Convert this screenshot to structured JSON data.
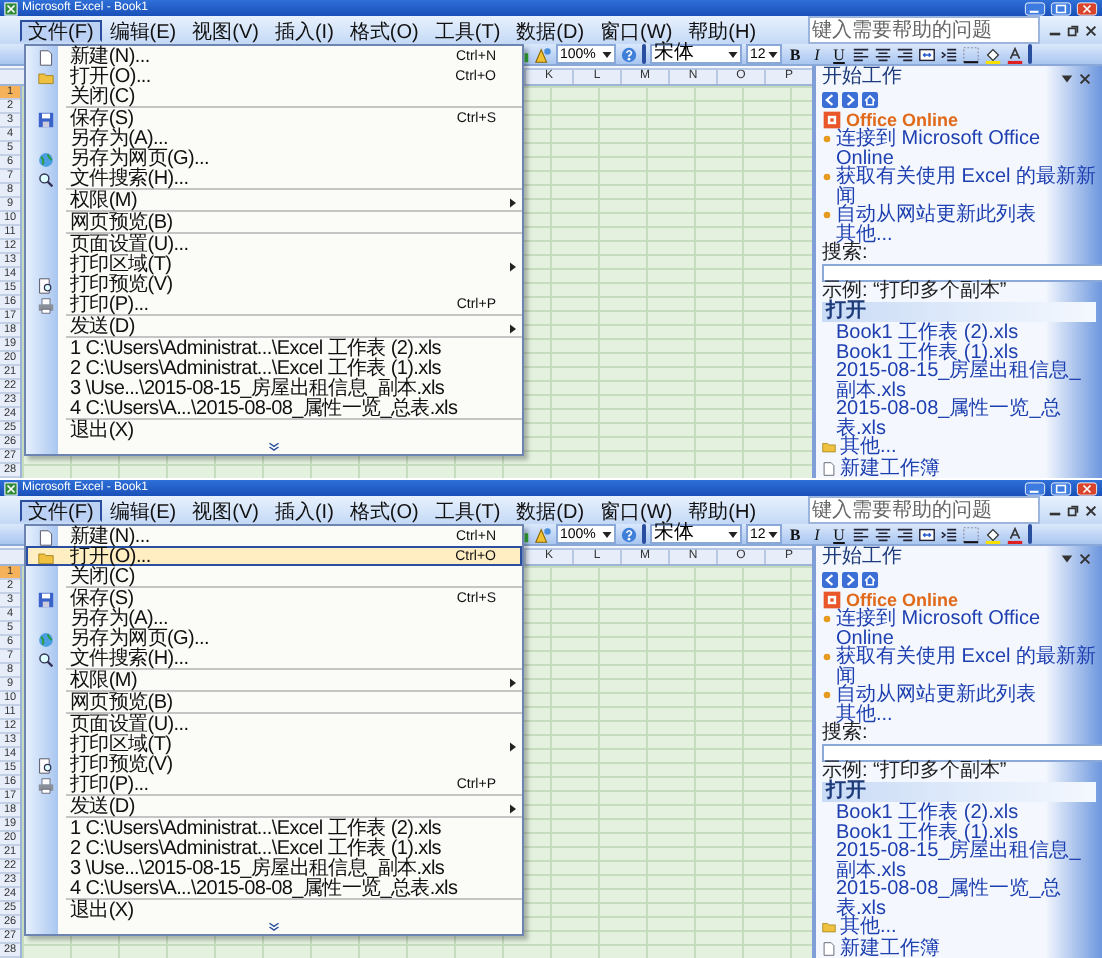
{
  "windows": [
    {
      "title": "Microsoft Excel - Book1",
      "menu_bar": [
        {
          "label": "文件(F)",
          "selected": true
        },
        {
          "label": "编辑(E)",
          "selected": false
        },
        {
          "label": "视图(V)",
          "selected": false
        },
        {
          "label": "插入(I)",
          "selected": false
        },
        {
          "label": "格式(O)",
          "selected": false
        },
        {
          "label": "工具(T)",
          "selected": false
        },
        {
          "label": "数据(D)",
          "selected": false
        },
        {
          "label": "窗口(W)",
          "selected": false
        },
        {
          "label": "帮助(H)",
          "selected": false
        }
      ],
      "help_placeholder": "键入需要帮助的问题",
      "toolbar": {
        "zoom": "100%",
        "font": "宋体",
        "size": "12",
        "format_buttons": [
          "B",
          "I",
          "U"
        ]
      },
      "file_menu": [
        {
          "label": "新建(N)...",
          "shortcut": "Ctrl+N",
          "selected": false,
          "submenu": false,
          "separator_after": false
        },
        {
          "label": "打开(O)...",
          "shortcut": "Ctrl+O",
          "selected": false,
          "submenu": false,
          "separator_after": false
        },
        {
          "label": "关闭(C)",
          "selected": false,
          "submenu": false,
          "separator_after": true
        },
        {
          "label": "保存(S)",
          "shortcut": "Ctrl+S",
          "selected": false,
          "submenu": false,
          "separator_after": false
        },
        {
          "label": "另存为(A)...",
          "selected": false,
          "submenu": false,
          "separator_after": false
        },
        {
          "label": "另存为网页(G)...",
          "selected": false,
          "submenu": false,
          "separator_after": false
        },
        {
          "label": "文件搜索(H)...",
          "selected": false,
          "submenu": false,
          "separator_after": true
        },
        {
          "label": "权限(M)",
          "selected": false,
          "submenu": true,
          "separator_after": true
        },
        {
          "label": "网页预览(B)",
          "selected": false,
          "submenu": false,
          "separator_after": true
        },
        {
          "label": "页面设置(U)...",
          "selected": false,
          "submenu": false,
          "separator_after": false
        },
        {
          "label": "打印区域(T)",
          "selected": false,
          "submenu": true,
          "separator_after": false
        },
        {
          "label": "打印预览(V)",
          "selected": false,
          "submenu": false,
          "separator_after": false
        },
        {
          "label": "打印(P)...",
          "shortcut": "Ctrl+P",
          "selected": false,
          "submenu": false,
          "separator_after": true
        },
        {
          "label": "发送(D)",
          "selected": false,
          "submenu": true,
          "separator_after": true
        },
        {
          "label": "1 C:\\Users\\Administrat...\\Excel 工作表 (2).xls",
          "selected": false,
          "submenu": false,
          "separator_after": false
        },
        {
          "label": "2 C:\\Users\\Administrat...\\Excel 工作表 (1).xls",
          "selected": false,
          "submenu": false,
          "separator_after": false
        },
        {
          "label": "3 \\Use...\\2015-08-15_房屋出租信息_副本.xls",
          "selected": false,
          "submenu": false,
          "separator_after": false
        },
        {
          "label": "4 C:\\Users\\A...\\2015-08-08_属性一览_总表.xls",
          "selected": false,
          "submenu": false,
          "separator_after": true
        },
        {
          "label": "退出(X)",
          "selected": false,
          "submenu": false,
          "separator_after": false
        }
      ],
      "columns": [
        "K",
        "L",
        "M",
        "N",
        "O",
        "P"
      ],
      "rows": [
        "1",
        "2",
        "3",
        "4",
        "5",
        "6",
        "7",
        "8",
        "9",
        "10",
        "11",
        "12",
        "13",
        "14",
        "15",
        "16",
        "17",
        "18",
        "19",
        "20",
        "21",
        "22",
        "23",
        "24",
        "25",
        "26",
        "27",
        "28"
      ],
      "task_pane": {
        "title": "开始工作",
        "logo": "Office Online",
        "links": [
          "连接到 Microsoft Office Online",
          "获取有关使用 Excel 的最新新闻",
          "自动从网站更新此列表"
        ],
        "more": "其他...",
        "search_label": "搜索:",
        "example": "示例: “打印多个副本”",
        "open_header": "打开",
        "files": [
          "Book1 工作表 (2).xls",
          "Book1 工作表 (1).xls",
          "2015-08-15_房屋出租信息_副本.xls",
          "2015-08-08_属性一览_总表.xls"
        ],
        "more_files": "其他...",
        "new_workbook": "新建工作簿"
      }
    },
    {
      "title": "Microsoft Excel - Book1",
      "menu_bar": [
        {
          "label": "文件(F)",
          "selected": true
        },
        {
          "label": "编辑(E)",
          "selected": false
        },
        {
          "label": "视图(V)",
          "selected": false
        },
        {
          "label": "插入(I)",
          "selected": false
        },
        {
          "label": "格式(O)",
          "selected": false
        },
        {
          "label": "工具(T)",
          "selected": false
        },
        {
          "label": "数据(D)",
          "selected": false
        },
        {
          "label": "窗口(W)",
          "selected": false
        },
        {
          "label": "帮助(H)",
          "selected": false
        }
      ],
      "help_placeholder": "键入需要帮助的问题",
      "toolbar": {
        "zoom": "100%",
        "font": "宋体",
        "size": "12",
        "format_buttons": [
          "B",
          "I",
          "U"
        ]
      },
      "file_menu": [
        {
          "label": "新建(N)...",
          "shortcut": "Ctrl+N",
          "selected": false,
          "submenu": false,
          "separator_after": false
        },
        {
          "label": "打开(O)...",
          "shortcut": "Ctrl+O",
          "selected": true,
          "submenu": false,
          "separator_after": false
        },
        {
          "label": "关闭(C)",
          "selected": false,
          "submenu": false,
          "separator_after": true
        },
        {
          "label": "保存(S)",
          "shortcut": "Ctrl+S",
          "selected": false,
          "submenu": false,
          "separator_after": false
        },
        {
          "label": "另存为(A)...",
          "selected": false,
          "submenu": false,
          "separator_after": false
        },
        {
          "label": "另存为网页(G)...",
          "selected": false,
          "submenu": false,
          "separator_after": false
        },
        {
          "label": "文件搜索(H)...",
          "selected": false,
          "submenu": false,
          "separator_after": true
        },
        {
          "label": "权限(M)",
          "selected": false,
          "submenu": true,
          "separator_after": true
        },
        {
          "label": "网页预览(B)",
          "selected": false,
          "submenu": false,
          "separator_after": true
        },
        {
          "label": "页面设置(U)...",
          "selected": false,
          "submenu": false,
          "separator_after": false
        },
        {
          "label": "打印区域(T)",
          "selected": false,
          "submenu": true,
          "separator_after": false
        },
        {
          "label": "打印预览(V)",
          "selected": false,
          "submenu": false,
          "separator_after": false
        },
        {
          "label": "打印(P)...",
          "shortcut": "Ctrl+P",
          "selected": false,
          "submenu": false,
          "separator_after": true
        },
        {
          "label": "发送(D)",
          "selected": false,
          "submenu": true,
          "separator_after": true
        },
        {
          "label": "1 C:\\Users\\Administrat...\\Excel 工作表 (2).xls",
          "selected": false,
          "submenu": false,
          "separator_after": false
        },
        {
          "label": "2 C:\\Users\\Administrat...\\Excel 工作表 (1).xls",
          "selected": false,
          "submenu": false,
          "separator_after": false
        },
        {
          "label": "3 \\Use...\\2015-08-15_房屋出租信息_副本.xls",
          "selected": false,
          "submenu": false,
          "separator_after": false
        },
        {
          "label": "4 C:\\Users\\A...\\2015-08-08_属性一览_总表.xls",
          "selected": false,
          "submenu": false,
          "separator_after": true
        },
        {
          "label": "退出(X)",
          "selected": false,
          "submenu": false,
          "separator_after": false
        }
      ],
      "columns": [
        "K",
        "L",
        "M",
        "N",
        "O",
        "P"
      ],
      "rows": [
        "1",
        "2",
        "3",
        "4",
        "5",
        "6",
        "7",
        "8",
        "9",
        "10",
        "11",
        "12",
        "13",
        "14",
        "15",
        "16",
        "17",
        "18",
        "19",
        "20",
        "21",
        "22",
        "23",
        "24",
        "25",
        "26",
        "27",
        "28"
      ],
      "task_pane": {
        "title": "开始工作",
        "logo": "Office Online",
        "links": [
          "连接到 Microsoft Office Online",
          "获取有关使用 Excel 的最新新闻",
          "自动从网站更新此列表"
        ],
        "more": "其他...",
        "search_label": "搜索:",
        "example": "示例: “打印多个副本”",
        "open_header": "打开",
        "files": [
          "Book1 工作表 (2).xls",
          "Book1 工作表 (1).xls",
          "2015-08-15_房屋出租信息_副本.xls",
          "2015-08-08_属性一览_总表.xls"
        ],
        "more_files": "其他...",
        "new_workbook": "新建工作簿"
      }
    }
  ]
}
